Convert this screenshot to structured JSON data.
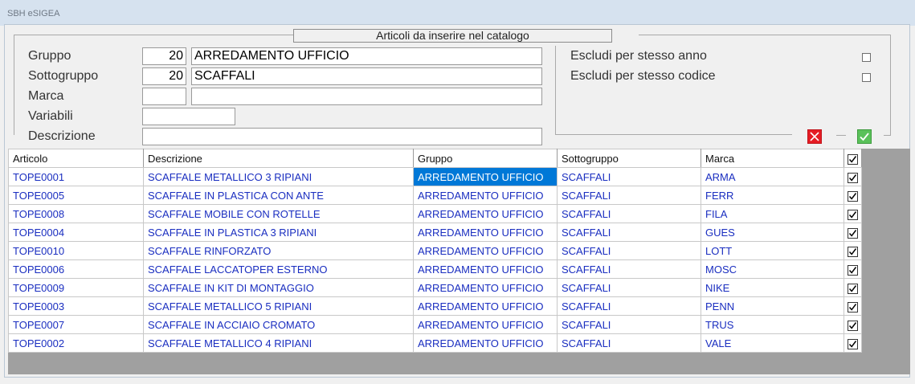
{
  "window": {
    "title": "SBH eSIGEA"
  },
  "section": {
    "title": "Articoli da inserire nel catalogo"
  },
  "form": {
    "gruppo": {
      "label": "Gruppo",
      "code": "20",
      "description": "ARREDAMENTO UFFICIO"
    },
    "sottogruppo": {
      "label": "Sottogruppo",
      "code": "20",
      "description": "SCAFFALI"
    },
    "marca": {
      "label": "Marca",
      "code": "",
      "description": ""
    },
    "variabili": {
      "label": "Variabili",
      "value": ""
    },
    "descrizione": {
      "label": "Descrizione",
      "value": ""
    }
  },
  "options": {
    "escludi_anno": {
      "label": "Escludi per stesso anno",
      "checked": false
    },
    "escludi_codice": {
      "label": "Escludi per stesso codice",
      "checked": false
    }
  },
  "actions": {
    "cancel_icon": "x-icon",
    "confirm_icon": "check-icon"
  },
  "colors": {
    "selection": "#0078d7",
    "link_text": "#1a2ec0",
    "cancel": "#e51c24",
    "confirm": "#5ac15a"
  },
  "grid": {
    "columns": [
      "Articolo",
      "Descrizione",
      "Gruppo",
      "Sottogruppo",
      "Marca"
    ],
    "rows": [
      {
        "articolo": "TOPE0001",
        "descrizione": "SCAFFALE METALLICO 3 RIPIANI",
        "gruppo": "ARREDAMENTO UFFICIO",
        "sottogruppo": "SCAFFALI",
        "marca": "ARMA",
        "checked": true
      },
      {
        "articolo": "TOPE0005",
        "descrizione": "SCAFFALE IN PLASTICA CON ANTE",
        "gruppo": "ARREDAMENTO UFFICIO",
        "sottogruppo": "SCAFFALI",
        "marca": "FERR",
        "checked": true
      },
      {
        "articolo": "TOPE0008",
        "descrizione": "SCAFFALE MOBILE CON ROTELLE",
        "gruppo": "ARREDAMENTO UFFICIO",
        "sottogruppo": "SCAFFALI",
        "marca": "FILA",
        "checked": true
      },
      {
        "articolo": "TOPE0004",
        "descrizione": "SCAFFALE IN PLASTICA 3 RIPIANI",
        "gruppo": "ARREDAMENTO UFFICIO",
        "sottogruppo": "SCAFFALI",
        "marca": "GUES",
        "checked": true
      },
      {
        "articolo": "TOPE0010",
        "descrizione": "SCAFFALE RINFORZATO",
        "gruppo": "ARREDAMENTO UFFICIO",
        "sottogruppo": "SCAFFALI",
        "marca": "LOTT",
        "checked": true
      },
      {
        "articolo": "TOPE0006",
        "descrizione": "SCAFFALE LACCATOPER ESTERNO",
        "gruppo": "ARREDAMENTO UFFICIO",
        "sottogruppo": "SCAFFALI",
        "marca": "MOSC",
        "checked": true
      },
      {
        "articolo": "TOPE0009",
        "descrizione": "SCAFFALE IN KIT DI MONTAGGIO",
        "gruppo": "ARREDAMENTO UFFICIO",
        "sottogruppo": "SCAFFALI",
        "marca": "NIKE",
        "checked": true
      },
      {
        "articolo": "TOPE0003",
        "descrizione": "SCAFFALE METALLICO 5 RIPIANI",
        "gruppo": "ARREDAMENTO UFFICIO",
        "sottogruppo": "SCAFFALI",
        "marca": "PENN",
        "checked": true
      },
      {
        "articolo": "TOPE0007",
        "descrizione": "SCAFFALE IN ACCIAIO CROMATO",
        "gruppo": "ARREDAMENTO UFFICIO",
        "sottogruppo": "SCAFFALI",
        "marca": "TRUS",
        "checked": true
      },
      {
        "articolo": "TOPE0002",
        "descrizione": "SCAFFALE METALLICO 4 RIPIANI",
        "gruppo": "ARREDAMENTO UFFICIO",
        "sottogruppo": "SCAFFALI",
        "marca": "VALE",
        "checked": true
      }
    ]
  }
}
